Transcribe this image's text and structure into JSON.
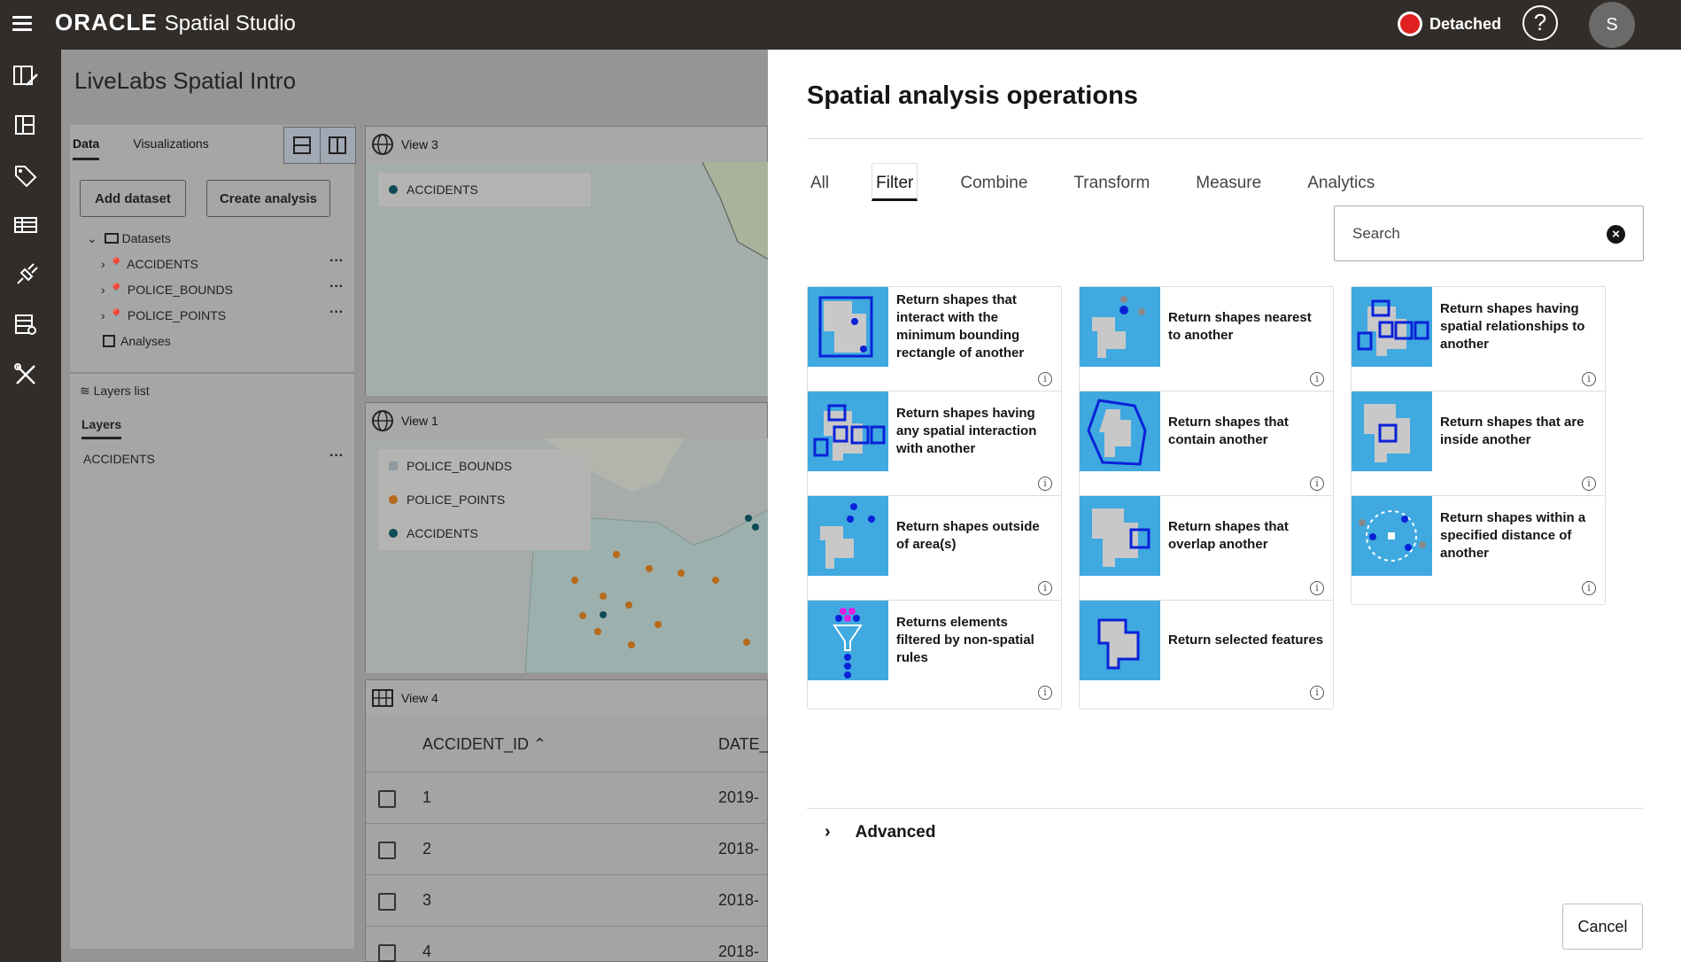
{
  "topbar": {
    "brand": "ORACLE",
    "product": "Spatial Studio",
    "status": "Detached",
    "help": "?",
    "avatar": "S"
  },
  "project": {
    "title": "LiveLabs Spatial Intro",
    "tabs": [
      "Data",
      "Visualizations"
    ],
    "add_dataset": "Add dataset",
    "create_analysis": "Create analysis",
    "tree": {
      "root": "Datasets",
      "items": [
        "ACCIDENTS",
        "POLICE_BOUNDS",
        "POLICE_POINTS"
      ],
      "analyses": "Analyses"
    },
    "layers_list": "Layers list",
    "layers_tab": "Layers",
    "layer_items": [
      "ACCIDENTS"
    ],
    "more": "···"
  },
  "views": {
    "view3": {
      "title": "View 3",
      "legend": [
        "ACCIDENTS"
      ]
    },
    "view1": {
      "title": "View 1",
      "legend": [
        "POLICE_BOUNDS",
        "POLICE_POINTS",
        "ACCIDENTS"
      ]
    },
    "view4": {
      "title": "View 4",
      "columns": [
        "ACCIDENT_ID",
        "DATE_"
      ],
      "rows": [
        {
          "id": "1",
          "date": "2019-"
        },
        {
          "id": "2",
          "date": "2018-"
        },
        {
          "id": "3",
          "date": "2018-"
        },
        {
          "id": "4",
          "date": "2018-"
        }
      ]
    }
  },
  "modal": {
    "title": "Spatial analysis operations",
    "tabs": [
      "All",
      "Filter",
      "Combine",
      "Transform",
      "Measure",
      "Analytics"
    ],
    "active_tab": "Filter",
    "search_placeholder": "Search",
    "cards": [
      "Return shapes that interact with the minimum bounding rectangle of another",
      "Return shapes nearest to another",
      "Return shapes having spatial relationships to another",
      "Return shapes having any spatial interaction with another",
      "Return shapes that contain another",
      "Return shapes that are inside another",
      "Return shapes outside of area(s)",
      "Return shapes that overlap another",
      "Return shapes within a specified distance of another",
      "Returns elements filtered by non-spatial rules",
      "Return selected features"
    ],
    "info_glyph": "i",
    "advanced": "Advanced",
    "cancel": "Cancel"
  },
  "colors": {
    "thumb_bg": "#3fa9e0",
    "shape_gray": "#c8c8c8",
    "shape_blue": "#0a22d8",
    "magenta": "#e020e0",
    "topbar": "#312d2a",
    "status_red": "#e02020"
  }
}
